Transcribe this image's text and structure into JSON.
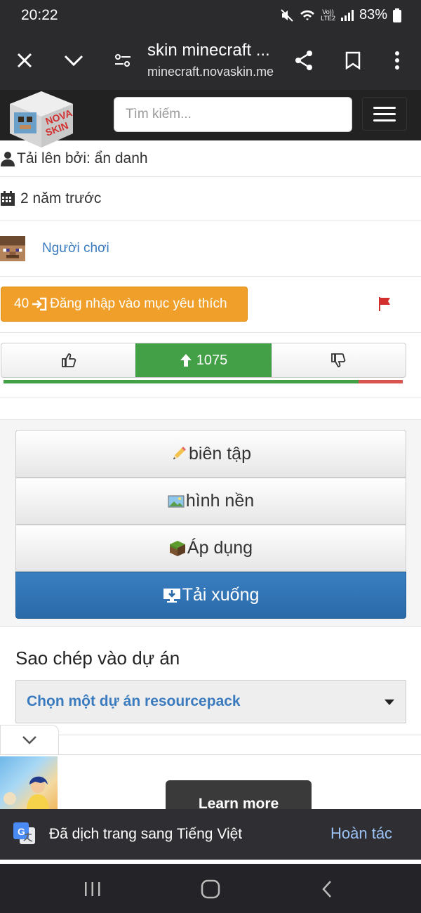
{
  "status": {
    "time": "20:22",
    "battery": "83%",
    "network_top": "Vo))",
    "network_bottom": "LTE2"
  },
  "browser": {
    "title": "skin minecraft ...",
    "url": "minecraft.novaskin.me"
  },
  "header": {
    "logo_text_top": "NOVA",
    "logo_text_bottom": "SKIN",
    "search_placeholder": "Tìm kiếm..."
  },
  "info": {
    "uploader": "Tải lên bởi: ẩn danh",
    "date": "2 năm trước",
    "player_link": "Người chơi"
  },
  "favorite": {
    "count": "40",
    "label": "Đăng nhập vào mục yêu thích"
  },
  "votes": {
    "score": "1075",
    "up_ratio": 0.89
  },
  "actions": {
    "edit": "biên tập",
    "background": "hình nền",
    "apply": "Áp dụng",
    "download": "Tải xuống"
  },
  "copy": {
    "title": "Sao chép vào dự án",
    "select_value": "Chọn một dự án resourcepack"
  },
  "ad": {
    "button": "Learn more"
  },
  "translate": {
    "message": "Đã dịch trang sang Tiếng Việt",
    "undo": "Hoàn tác"
  },
  "colors": {
    "accent_orange": "#f0a02a",
    "vote_green": "#43a047",
    "download_blue": "#2a6aa9",
    "link_blue": "#3a7bbf"
  }
}
